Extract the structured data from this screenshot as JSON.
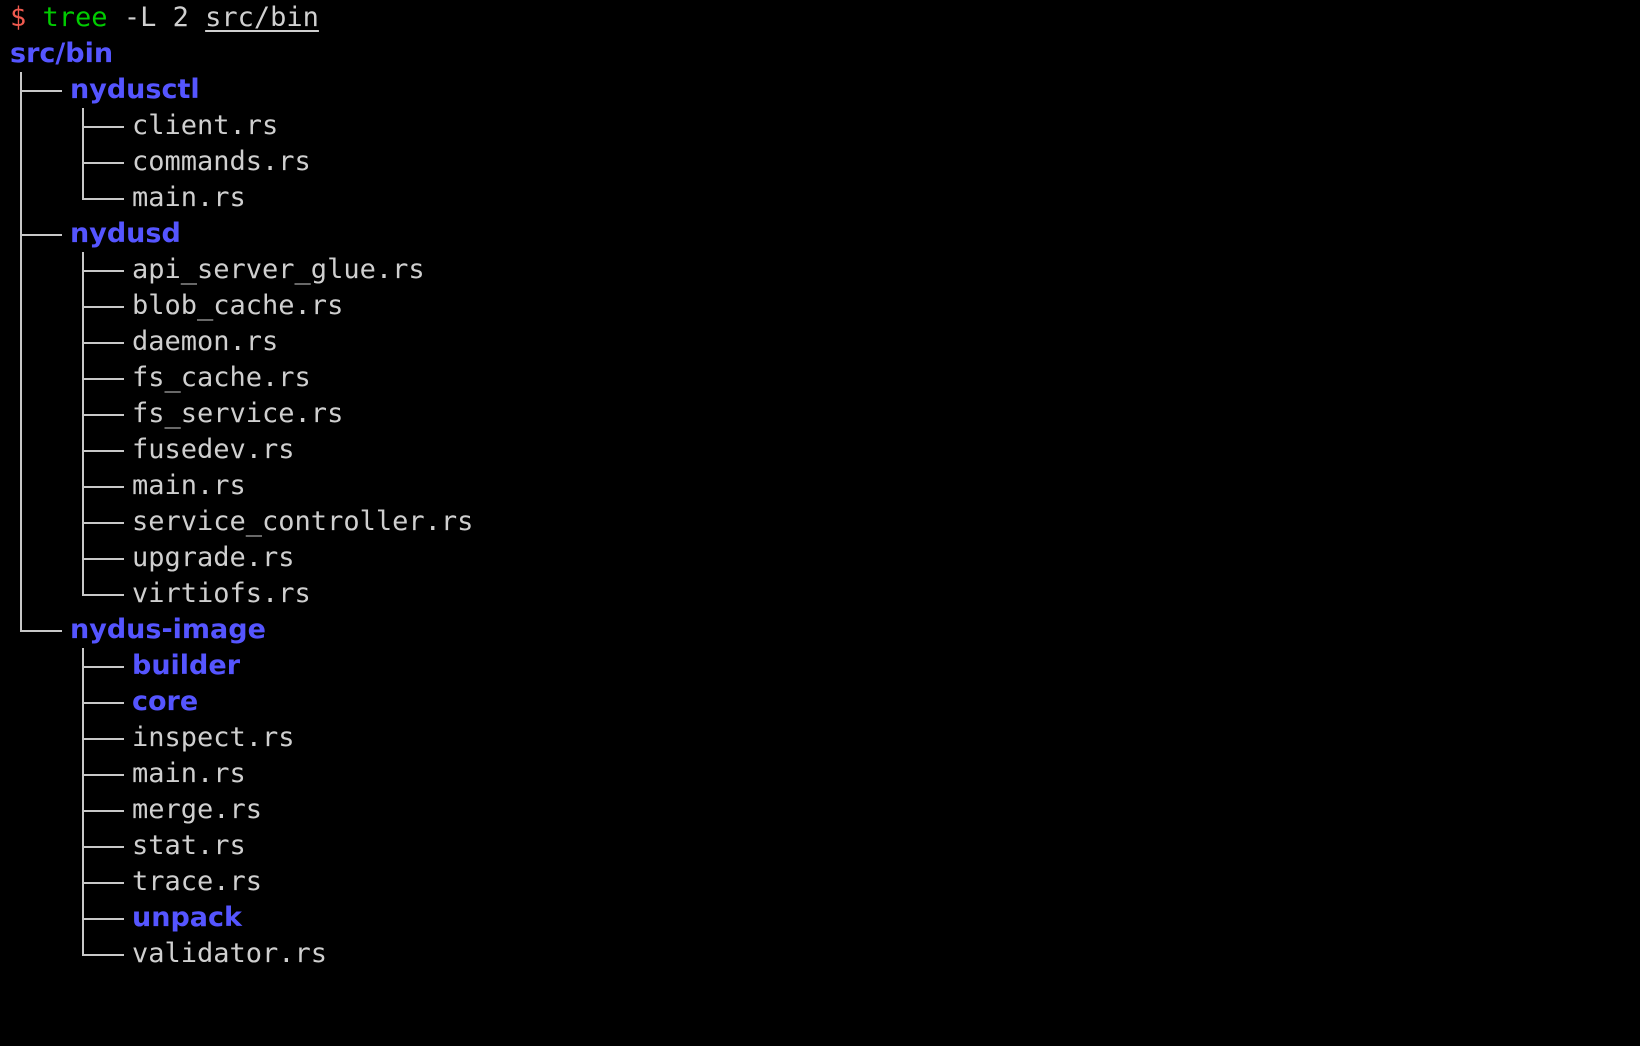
{
  "terminal": {
    "background_color": "#000000",
    "prompt": {
      "sigil": "$",
      "sigil_color": "#f05a4f",
      "command": "tree",
      "command_color": "#00cc00",
      "flags": "-L 2",
      "argument": "src/bin",
      "argument_color": "#d0d0d0"
    },
    "colors": {
      "directory": "#5555ff",
      "file": "#cfcfcf",
      "guide": "#c8c8c8"
    },
    "tree": {
      "root": "src/bin",
      "root_type": "dir",
      "rows": [
        {
          "level": 1,
          "text": "nydusctl",
          "type": "dir",
          "last": false
        },
        {
          "level": 2,
          "text": "client.rs",
          "type": "file",
          "last": false
        },
        {
          "level": 2,
          "text": "commands.rs",
          "type": "file",
          "last": false
        },
        {
          "level": 2,
          "text": "main.rs",
          "type": "file",
          "last": true
        },
        {
          "level": 1,
          "text": "nydusd",
          "type": "dir",
          "last": false
        },
        {
          "level": 2,
          "text": "api_server_glue.rs",
          "type": "file",
          "last": false
        },
        {
          "level": 2,
          "text": "blob_cache.rs",
          "type": "file",
          "last": false
        },
        {
          "level": 2,
          "text": "daemon.rs",
          "type": "file",
          "last": false
        },
        {
          "level": 2,
          "text": "fs_cache.rs",
          "type": "file",
          "last": false
        },
        {
          "level": 2,
          "text": "fs_service.rs",
          "type": "file",
          "last": false
        },
        {
          "level": 2,
          "text": "fusedev.rs",
          "type": "file",
          "last": false
        },
        {
          "level": 2,
          "text": "main.rs",
          "type": "file",
          "last": false
        },
        {
          "level": 2,
          "text": "service_controller.rs",
          "type": "file",
          "last": false
        },
        {
          "level": 2,
          "text": "upgrade.rs",
          "type": "file",
          "last": false
        },
        {
          "level": 2,
          "text": "virtiofs.rs",
          "type": "file",
          "last": true
        },
        {
          "level": 1,
          "text": "nydus-image",
          "type": "dir",
          "last": true
        },
        {
          "level": 2,
          "text": "builder",
          "type": "dir",
          "last": false
        },
        {
          "level": 2,
          "text": "core",
          "type": "dir",
          "last": false
        },
        {
          "level": 2,
          "text": "inspect.rs",
          "type": "file",
          "last": false
        },
        {
          "level": 2,
          "text": "main.rs",
          "type": "file",
          "last": false
        },
        {
          "level": 2,
          "text": "merge.rs",
          "type": "file",
          "last": false
        },
        {
          "level": 2,
          "text": "stat.rs",
          "type": "file",
          "last": false
        },
        {
          "level": 2,
          "text": "trace.rs",
          "type": "file",
          "last": false
        },
        {
          "level": 2,
          "text": "unpack",
          "type": "dir",
          "last": false
        },
        {
          "level": 2,
          "text": "validator.rs",
          "type": "file",
          "last": true
        }
      ]
    }
  }
}
